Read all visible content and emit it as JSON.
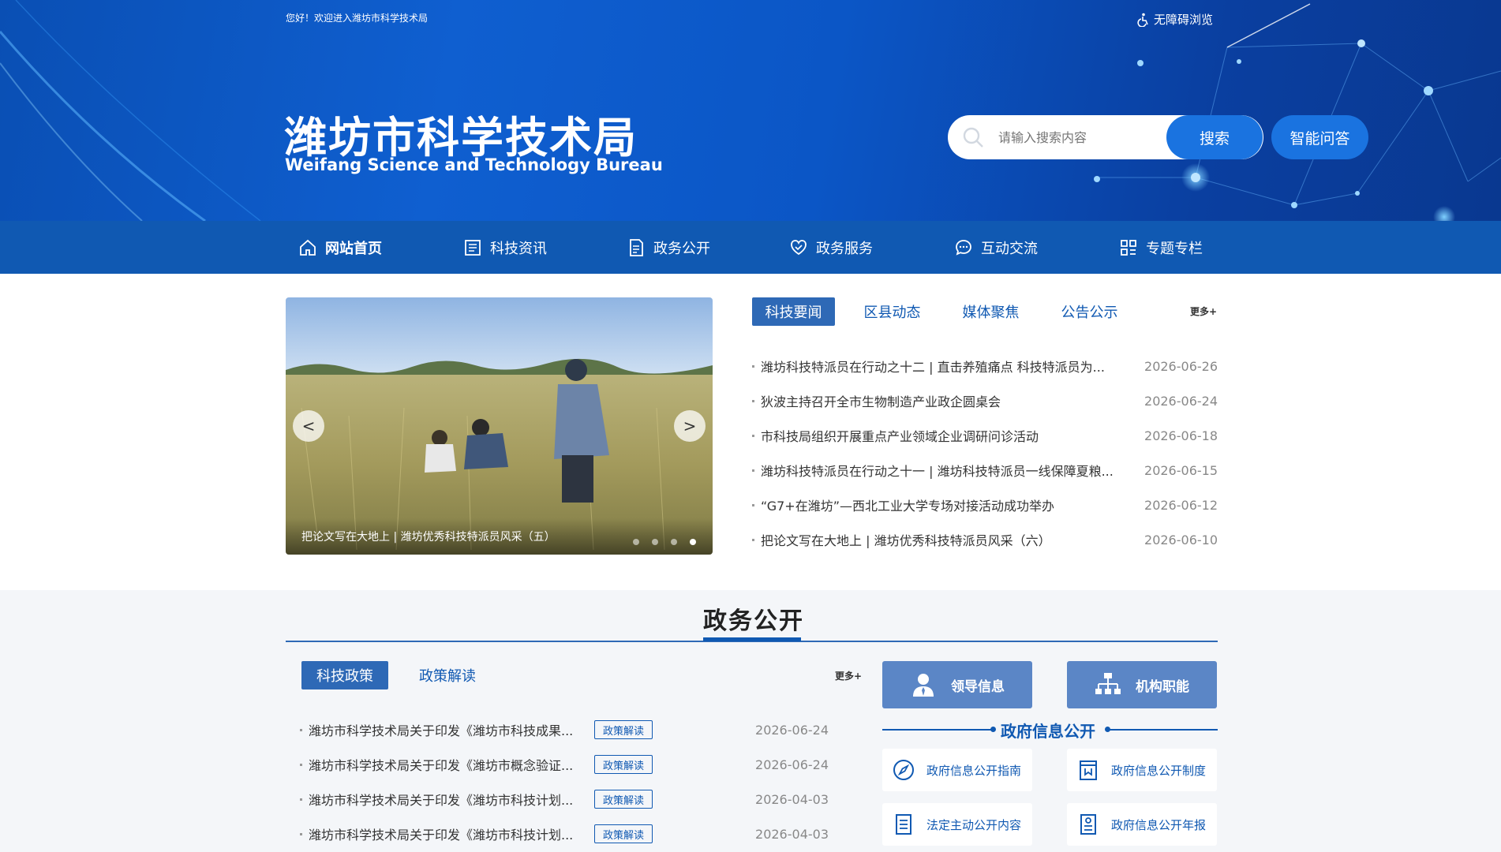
{
  "header": {
    "welcome": "您好！欢迎进入潍坊市科学技术局",
    "accessibility": "无障碍浏览",
    "title": "潍坊市科学技术局",
    "subtitle": "Weifang Science and Technology Bureau",
    "search_placeholder": "请输入搜索内容",
    "search_button": "搜索",
    "qa_button": "智能问答"
  },
  "nav": [
    {
      "label": "网站首页",
      "icon": "home-icon",
      "active": true
    },
    {
      "label": "科技资讯",
      "icon": "news-icon"
    },
    {
      "label": "政务公开",
      "icon": "document-icon"
    },
    {
      "label": "政务服务",
      "icon": "service-icon"
    },
    {
      "label": "互动交流",
      "icon": "chat-icon"
    },
    {
      "label": "专题专栏",
      "icon": "grid-icon"
    }
  ],
  "carousel": {
    "caption": "把论文写在大地上 | 潍坊优秀科技特派员风采（五）",
    "prev": "<",
    "next": ">"
  },
  "news_tabs": [
    "科技要闻",
    "区县动态",
    "媒体聚焦",
    "公告公示"
  ],
  "more": "更多+",
  "news": [
    {
      "title": "潍坊科技特派员在行动之十二 | 直击养殖痛点 科技特派员为...",
      "date": "2026-06-26"
    },
    {
      "title": "狄波主持召开全市生物制造产业政企圆桌会",
      "date": "2026-06-24"
    },
    {
      "title": "市科技局组织开展重点产业领域企业调研问诊活动",
      "date": "2026-06-18"
    },
    {
      "title": "潍坊科技特派员在行动之十一 | 潍坊科技特派员一线保障夏粮...",
      "date": "2026-06-15"
    },
    {
      "title": "“G7+在潍坊”—西北工业大学专场对接活动成功举办",
      "date": "2026-06-12"
    },
    {
      "title": "把论文写在大地上 | 潍坊优秀科技特派员风采（六）",
      "date": "2026-06-10"
    }
  ],
  "gov": {
    "title": "政务公开",
    "tabs": [
      "科技政策",
      "政策解读"
    ],
    "policies": [
      {
        "title": "潍坊市科学技术局关于印发《潍坊市科技成果...",
        "tag": "政策解读",
        "date": "2026-06-24"
      },
      {
        "title": "潍坊市科学技术局关于印发《潍坊市概念验证...",
        "tag": "政策解读",
        "date": "2026-06-24"
      },
      {
        "title": "潍坊市科学技术局关于印发《潍坊市科技计划...",
        "tag": "政策解读",
        "date": "2026-04-03"
      },
      {
        "title": "潍坊市科学技术局关于印发《潍坊市科技计划...",
        "tag": "政策解读",
        "date": "2026-04-03"
      }
    ],
    "leader_button": "领导信息",
    "org_button": "机构职能",
    "info_title": "政府信息公开",
    "info_links": [
      "政府信息公开指南",
      "政府信息公开制度",
      "法定主动公开内容",
      "政府信息公开年报"
    ]
  },
  "colors": {
    "primary": "#1059b2",
    "banner": "#0b56c6",
    "button": "#1a73e0",
    "tab_active": "#2e69b6"
  }
}
